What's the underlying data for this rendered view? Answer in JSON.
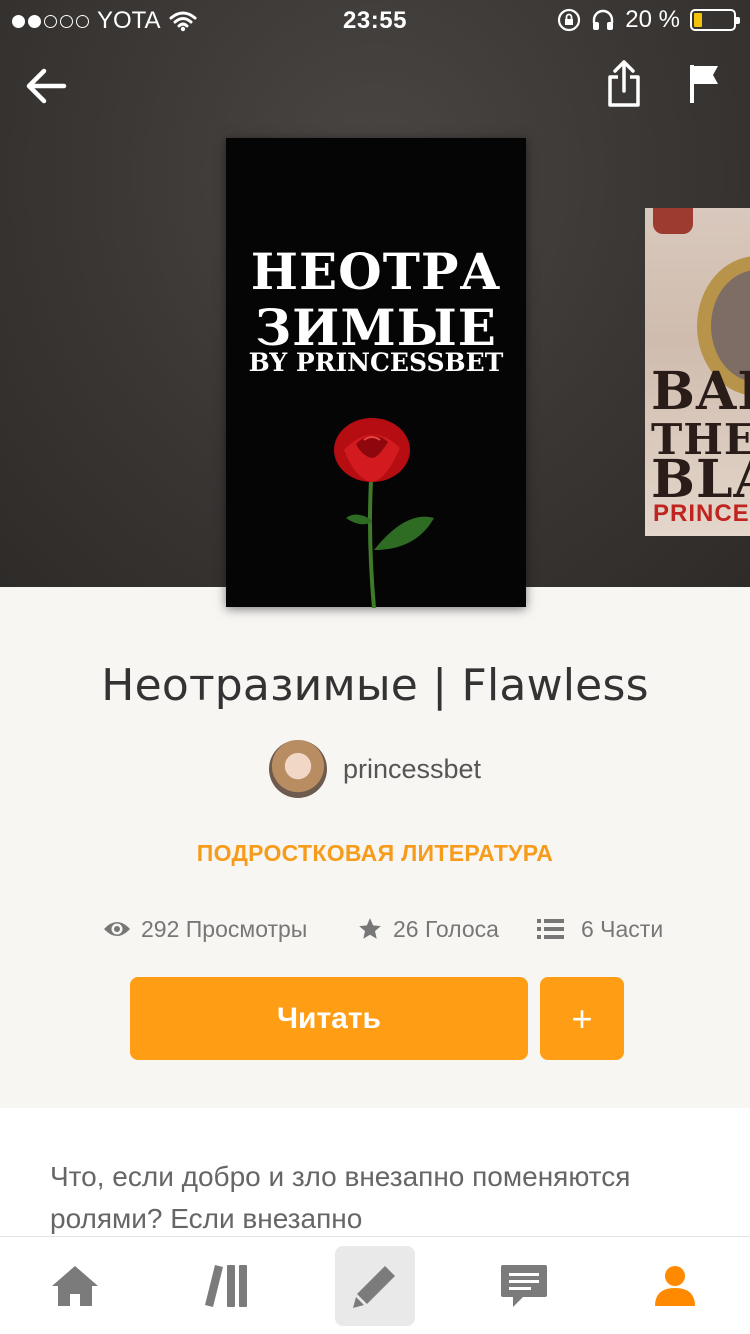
{
  "status_bar": {
    "carrier": "YOTA",
    "time": "23:55",
    "battery_percent": "20 %",
    "battery_level": 0.2
  },
  "cover": {
    "title_line1": "НЕОТРА",
    "title_line2": "ЗИМЫЕ",
    "byline": "BY PRINCESSBET"
  },
  "next_cover": {
    "line1": "BAD",
    "line2": "THE",
    "line3": "BLA",
    "author_fragment": "PRINCE"
  },
  "story": {
    "title": "Неотразимые | Flawless",
    "author": "princessbet",
    "category": "ПОДРОСТКОВАЯ ЛИТЕРАТУРА",
    "stats": {
      "views": "292 Просмотры",
      "votes": "26 Голоса",
      "parts": "6 Части"
    },
    "read_label": "Читать",
    "add_label": "+",
    "description": "Что, если добро и зло внезапно поменяются ролями? Если внезапно"
  },
  "icons": {
    "back": "arrow-left-icon",
    "share": "share-icon",
    "flag": "flag-icon",
    "views": "eye-icon",
    "votes": "star-icon",
    "parts": "list-icon"
  },
  "tabs": [
    {
      "name": "home",
      "icon": "home-icon"
    },
    {
      "name": "library",
      "icon": "library-icon"
    },
    {
      "name": "write",
      "icon": "pencil-icon",
      "active": true
    },
    {
      "name": "messages",
      "icon": "chat-icon"
    },
    {
      "name": "profile",
      "icon": "person-icon"
    }
  ],
  "colors": {
    "accent": "#ff9d15",
    "category": "#f69b1a",
    "profile_tab": "#ff8a00"
  }
}
